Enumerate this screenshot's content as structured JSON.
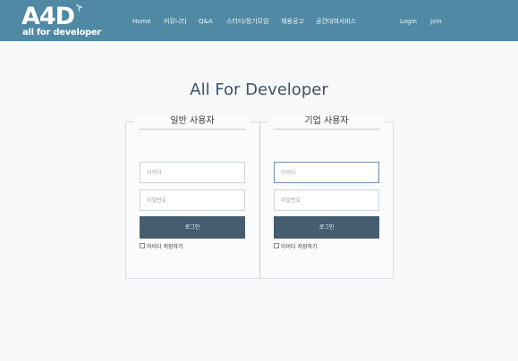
{
  "brand": {
    "logo": "A4D",
    "tagline": "all for developer"
  },
  "nav": {
    "items": [
      "Home",
      "커뮤니티",
      "Q&A",
      "스터디/정기모임",
      "채용공고",
      "공간대여서비스"
    ],
    "login": "Login",
    "join": "Join"
  },
  "page": {
    "title": "All For Developer"
  },
  "general": {
    "heading": "일반 사용자",
    "id_placeholder": "아이디",
    "pw_placeholder": "비밀번호",
    "login_button": "로그인",
    "save_id": "아이디 저장하기"
  },
  "company": {
    "heading": "기업 사용자",
    "id_placeholder": "아이디",
    "pw_placeholder": "비밀번호",
    "login_button": "로그인",
    "save_id": "아이디 저장하기"
  },
  "colors": {
    "header": "#4f89a4",
    "button": "#465d70",
    "title": "#3e5368"
  }
}
